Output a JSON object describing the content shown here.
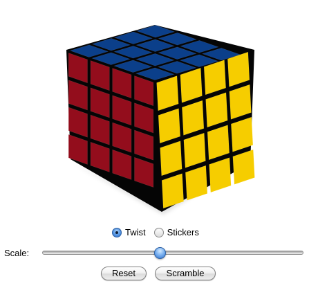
{
  "cube": {
    "size": 4,
    "faces": {
      "top": "blue",
      "left": "red",
      "right": "yellow"
    },
    "colors": {
      "blue": "#0b3f8a",
      "red": "#930d1c",
      "yellow": "#f6cd00",
      "body": "#050505"
    }
  },
  "mode": {
    "selected": "twist",
    "options": [
      {
        "id": "twist",
        "label": "Twist"
      },
      {
        "id": "stickers",
        "label": "Stickers"
      }
    ]
  },
  "scale": {
    "label": "Scale:",
    "value": 0.45
  },
  "buttons": {
    "reset_label": "Reset",
    "scramble_label": "Scramble"
  }
}
